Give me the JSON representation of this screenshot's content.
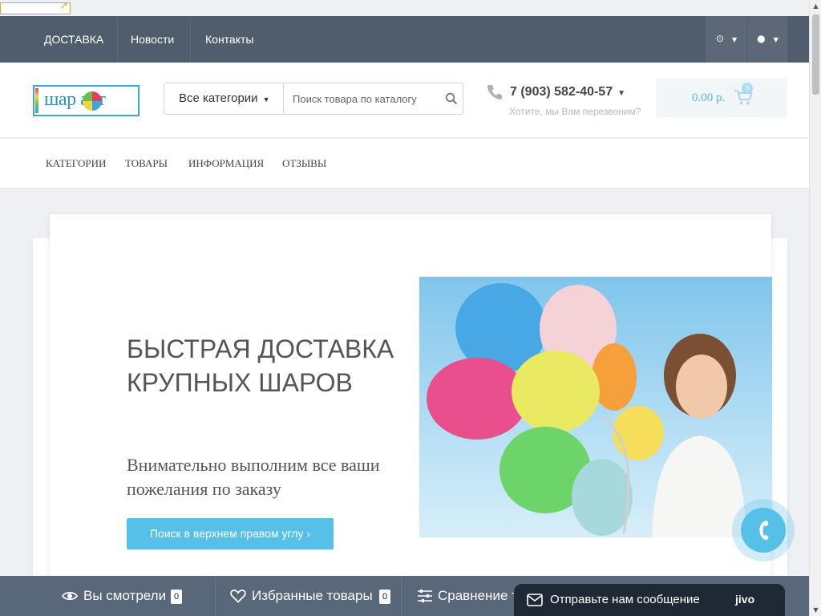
{
  "topbar": {
    "links": [
      "ДОСТАВКА",
      "Новости",
      "Контакты"
    ],
    "tools": [
      "clock-icon",
      "user-icon"
    ]
  },
  "header": {
    "logo_text": "шар арт",
    "category_select": "Все категории",
    "search_placeholder": "Поиск товара по каталогу",
    "phone": "7 (903) 582-40-57",
    "callback": "Хотите, мы Вам перезвоним?",
    "cart_total": "0.00 р.",
    "cart_count": "0"
  },
  "mainnav": {
    "items": [
      "КАТЕГОРИИ",
      "ТОВАРЫ",
      "ИНФОРМАЦИЯ",
      "ОТЗЫВЫ"
    ]
  },
  "hero": {
    "title": "БЫСТРАЯ ДОСТАВКА КРУПНЫХ ШАРОВ",
    "subtitle": "Внимательно выполним все ваши пожелания по заказу",
    "button": "Поиск в верхнем правом углу"
  },
  "bottombar": {
    "viewed_label": "Вы смотрели",
    "viewed_count": "0",
    "favorites_label": "Избранные товары",
    "favorites_count": "0",
    "compare_label": "Сравнение т"
  },
  "chat": {
    "message": "Отправьте нам сообщение",
    "brand": "jivo"
  },
  "colors": {
    "accent": "#57c0e9",
    "topbar": "#505d6d",
    "bottombar": "#58677a"
  }
}
